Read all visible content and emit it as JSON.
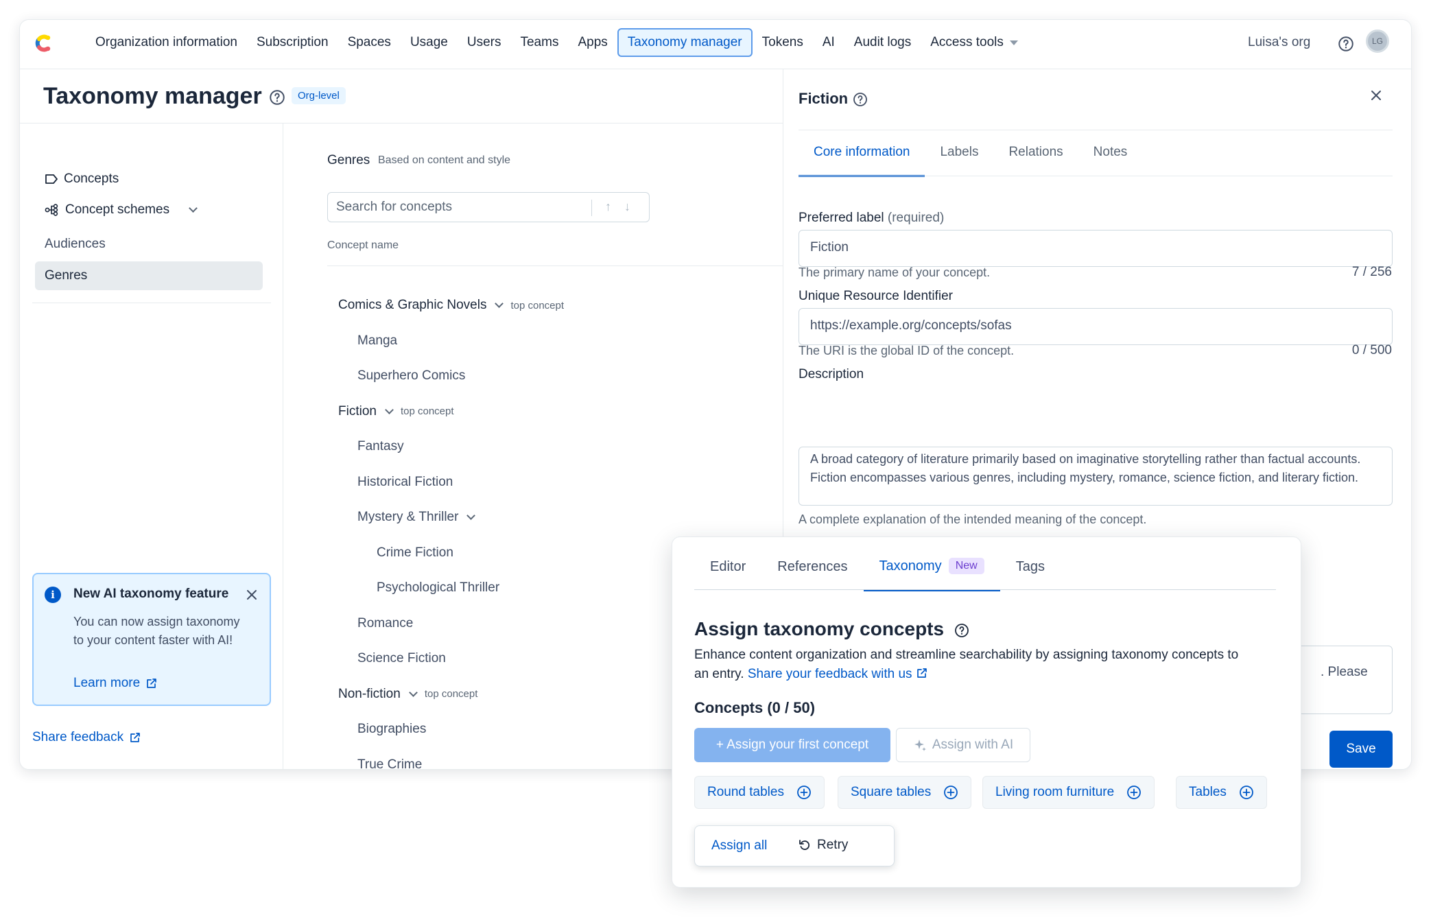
{
  "nav": {
    "items": [
      "Organization information",
      "Subscription",
      "Spaces",
      "Usage",
      "Users",
      "Teams",
      "Apps",
      "Taxonomy manager",
      "Tokens",
      "AI",
      "Audit logs",
      "Access tools"
    ],
    "active": "Taxonomy manager",
    "org_name": "Luisa's org",
    "avatar_initials": "LG"
  },
  "header": {
    "title": "Taxonomy manager",
    "badge": "Org-level"
  },
  "sidebar": {
    "items": [
      {
        "label": "Concepts",
        "icon": "tag-icon"
      },
      {
        "label": "Concept schemes",
        "icon": "hierarchy-icon"
      },
      {
        "label": "Audiences"
      },
      {
        "label": "Genres",
        "selected": true
      }
    ],
    "info": {
      "title": "New AI taxonomy feature",
      "body": "You can now assign taxonomy to your content faster with AI!",
      "link": "Learn more"
    },
    "share_feedback": "Share feedback"
  },
  "list": {
    "heading": "Genres",
    "subheading": "Based on content and style",
    "search_placeholder": "Search for concepts",
    "column_header": "Concept name",
    "top_concept_label": "top concept",
    "concepts": [
      {
        "label": "Comics & Graphic Novels",
        "level": 0,
        "top": true,
        "expand": true
      },
      {
        "label": "Manga",
        "level": 1
      },
      {
        "label": "Superhero Comics",
        "level": 1
      },
      {
        "label": "Fiction",
        "level": 0,
        "top": true,
        "expand": true
      },
      {
        "label": "Fantasy",
        "level": 1
      },
      {
        "label": "Historical Fiction",
        "level": 1
      },
      {
        "label": "Mystery & Thriller",
        "level": 1,
        "expand": true
      },
      {
        "label": "Crime Fiction",
        "level": 2
      },
      {
        "label": "Psychological Thriller",
        "level": 2
      },
      {
        "label": "Romance",
        "level": 1
      },
      {
        "label": "Science Fiction",
        "level": 1
      },
      {
        "label": "Non-fiction",
        "level": 0,
        "top": true,
        "expand": true
      },
      {
        "label": "Biographies",
        "level": 1
      },
      {
        "label": "True Crime",
        "level": 1
      }
    ]
  },
  "detail": {
    "title": "Fiction",
    "tabs": [
      "Core information",
      "Labels",
      "Relations",
      "Notes"
    ],
    "active_tab": "Core information",
    "preferred_label": {
      "label": "Preferred label",
      "required": "(required)",
      "value": "Fiction",
      "help": "The primary name of your concept.",
      "count": "7 / 256"
    },
    "uri": {
      "label": "Unique Resource Identifier",
      "placeholder": "https://example.org/concepts/sofas",
      "help": "The URI is the global ID of the concept.",
      "count": "0 / 500"
    },
    "description": {
      "label": "Description",
      "value": "A broad category of literature primarily based on imaginative storytelling rather than factual accounts. Fiction encompasses various genres, including mystery, romance, science fiction, and literary fiction.",
      "help": "A complete explanation of the intended meaning of the concept."
    },
    "partial_text": ". Please",
    "save": "Save"
  },
  "card": {
    "tabs": [
      "Editor",
      "References",
      "Taxonomy",
      "Tags"
    ],
    "active_tab": "Taxonomy",
    "new_badge": "New",
    "title": "Assign taxonomy concepts",
    "description": "Enhance content organization and streamline searchability by assigning taxonomy concepts to an entry.",
    "feedback_link": "Share your feedback with us",
    "concepts_count": "Concepts (0 / 50)",
    "assign_first": "+ Assign your first concept",
    "assign_ai": "Assign with AI",
    "suggestions": [
      "Round tables",
      "Square tables",
      "Living room furniture",
      "Tables"
    ],
    "assign_all": "Assign all",
    "retry": "Retry"
  },
  "colors": {
    "accent": "#0059c8",
    "accent_bg": "#e8f5ff",
    "new_badge": "#6c3ecf"
  }
}
